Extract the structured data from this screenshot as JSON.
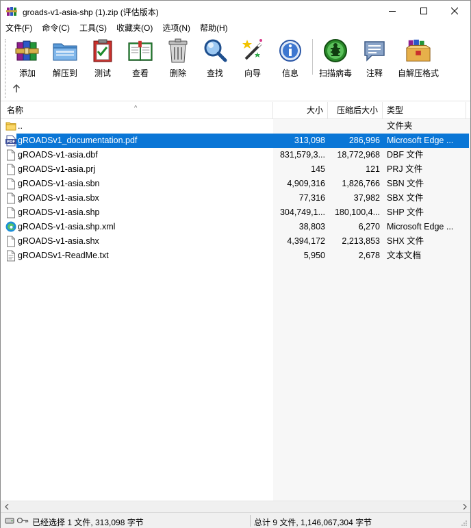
{
  "window": {
    "title": "groads-v1-asia-shp (1).zip (评估版本)"
  },
  "menu": [
    {
      "label": "文件(F)"
    },
    {
      "label": "命令(C)"
    },
    {
      "label": "工具(S)"
    },
    {
      "label": "收藏夹(O)"
    },
    {
      "label": "选项(N)"
    },
    {
      "label": "帮助(H)"
    }
  ],
  "toolbar": {
    "buttons": [
      {
        "label": "添加",
        "icon": "books-add-icon"
      },
      {
        "label": "解压到",
        "icon": "folder-extract-icon"
      },
      {
        "label": "测试",
        "icon": "clipboard-test-icon"
      },
      {
        "label": "查看",
        "icon": "book-view-icon"
      },
      {
        "label": "删除",
        "icon": "trash-icon"
      },
      {
        "label": "查找",
        "icon": "magnifier-icon"
      },
      {
        "label": "向导",
        "icon": "wizard-wand-icon"
      },
      {
        "label": "信息",
        "icon": "info-icon"
      },
      {
        "label": "扫描病毒",
        "icon": "virus-scan-icon"
      },
      {
        "label": "注释",
        "icon": "comment-icon"
      },
      {
        "label": "自解压格式",
        "icon": "sfx-box-icon"
      }
    ],
    "up_icon": "arrow-up-icon"
  },
  "columns": {
    "name": "名称",
    "size": "大小",
    "packed": "压缩后大小",
    "type": "类型"
  },
  "files": [
    {
      "name": "..",
      "size": "",
      "packed": "",
      "type": "文件夹",
      "icon": "folder-icon",
      "selected": false
    },
    {
      "name": "gROADSv1_documentation.pdf",
      "size": "313,098",
      "packed": "286,996",
      "type": "Microsoft Edge ...",
      "icon": "pdf-icon",
      "selected": true
    },
    {
      "name": "gROADS-v1-asia.dbf",
      "size": "831,579,3...",
      "packed": "18,772,968",
      "type": "DBF 文件",
      "icon": "file-icon",
      "selected": false
    },
    {
      "name": "gROADS-v1-asia.prj",
      "size": "145",
      "packed": "121",
      "type": "PRJ 文件",
      "icon": "file-icon",
      "selected": false
    },
    {
      "name": "gROADS-v1-asia.sbn",
      "size": "4,909,316",
      "packed": "1,826,766",
      "type": "SBN 文件",
      "icon": "file-icon",
      "selected": false
    },
    {
      "name": "gROADS-v1-asia.sbx",
      "size": "77,316",
      "packed": "37,982",
      "type": "SBX 文件",
      "icon": "file-icon",
      "selected": false
    },
    {
      "name": "gROADS-v1-asia.shp",
      "size": "304,749,1...",
      "packed": "180,100,4...",
      "type": "SHP 文件",
      "icon": "file-icon",
      "selected": false
    },
    {
      "name": "gROADS-v1-asia.shp.xml",
      "size": "38,803",
      "packed": "6,270",
      "type": "Microsoft Edge ...",
      "icon": "edge-icon",
      "selected": false
    },
    {
      "name": "gROADS-v1-asia.shx",
      "size": "4,394,172",
      "packed": "2,213,853",
      "type": "SHX 文件",
      "icon": "file-icon",
      "selected": false
    },
    {
      "name": "gROADSv1-ReadMe.txt",
      "size": "5,950",
      "packed": "2,678",
      "type": "文本文档",
      "icon": "text-file-icon",
      "selected": false
    }
  ],
  "status": {
    "left": "已经选择 1 文件, 313,098 字节",
    "right": "总计 9 文件, 1,146,067,304 字节"
  },
  "colors": {
    "selection": "#0a76d6"
  }
}
